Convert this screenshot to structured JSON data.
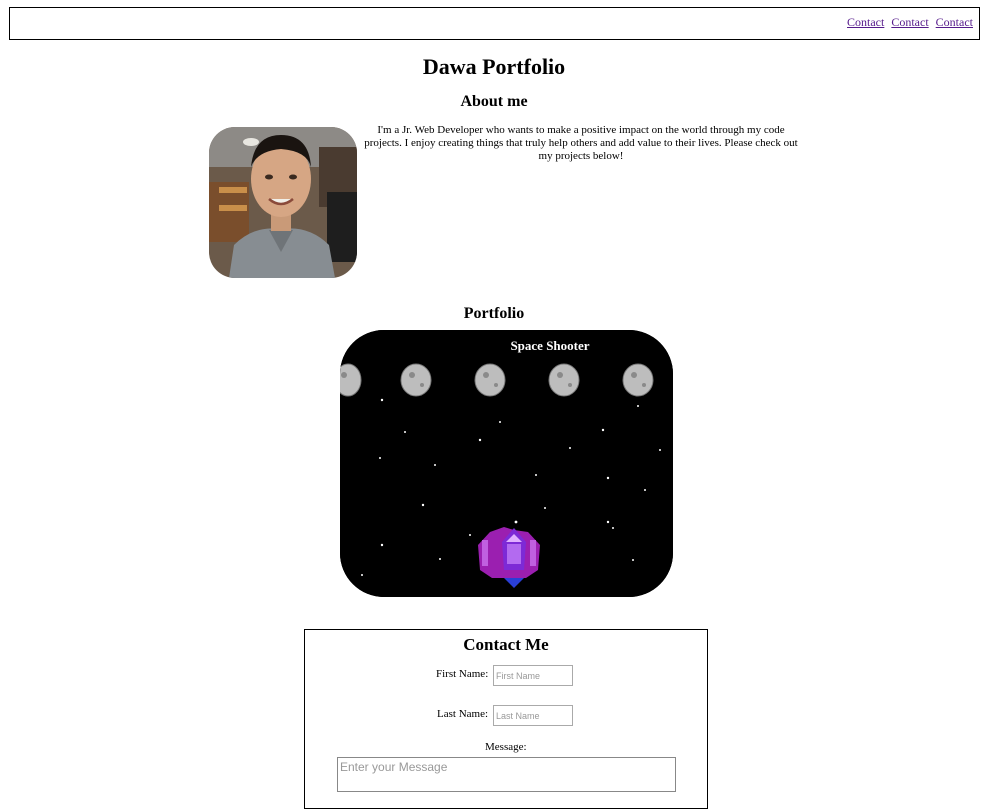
{
  "nav": {
    "links": [
      "Contact",
      "Contact",
      "Contact"
    ]
  },
  "page_title": "Dawa Portfolio",
  "about": {
    "heading": "About me",
    "text": "I'm a Jr. Web Developer who wants to make a positive impact on the world through my code projects. I enjoy creating things that truly help others and add value to their lives. Please check out my projects below!"
  },
  "portfolio": {
    "heading": "Portfolio",
    "project_title": "Space Shooter"
  },
  "contact": {
    "heading": "Contact Me",
    "first_name_label": "First Name:",
    "first_name_placeholder": "First Name",
    "last_name_label": "Last Name:",
    "last_name_placeholder": "Last Name",
    "message_label": "Message:",
    "message_placeholder": "Enter your Message"
  },
  "colors": {
    "link": "#551a8b",
    "ship": "#9b1fb0",
    "space": "#000000"
  }
}
